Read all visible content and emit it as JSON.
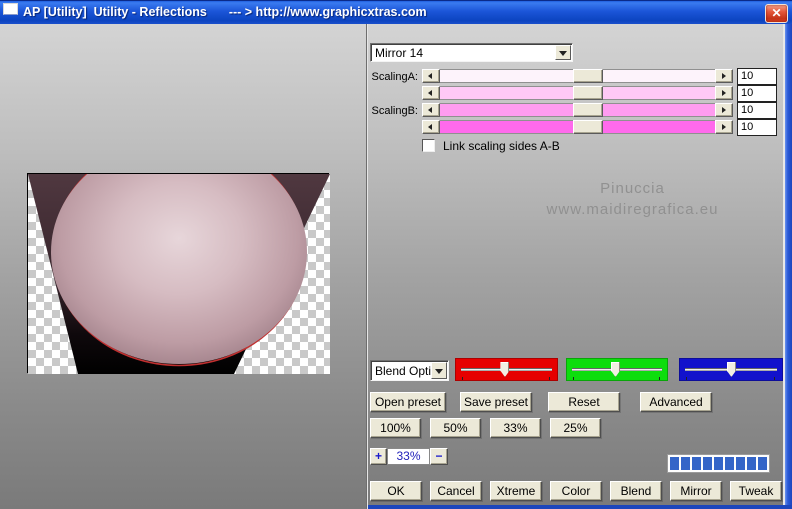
{
  "window": {
    "title_left": "AP [Utility]  Utility - Reflections",
    "title_right": "--- > http://www.graphicxtras.com",
    "close_label": "✕"
  },
  "mirror_select": {
    "value": "Mirror 14"
  },
  "scaling": {
    "rows": [
      {
        "label": "ScalingA:",
        "value": "10",
        "track_color": "#fdf3fb"
      },
      {
        "label": "",
        "value": "10",
        "track_color": "#ffc9f6"
      },
      {
        "label": "ScalingB:",
        "value": "10",
        "track_color": "#ff9cf0"
      },
      {
        "label": "",
        "value": "10",
        "track_color": "#ff6aec"
      }
    ],
    "link_checkbox_label": "Link scaling sides A-B",
    "link_checked": false
  },
  "watermark": {
    "line1": "Pinuccia",
    "line2": "www.maidiregrafica.eu"
  },
  "blend": {
    "select_value": "Blend Optio",
    "channel_sliders": [
      {
        "name": "red",
        "color": "#e60000",
        "thumb_left": "44%"
      },
      {
        "name": "green",
        "color": "#0ddd0d",
        "thumb_left": "44%"
      },
      {
        "name": "blue",
        "color": "#1212cc",
        "thumb_left": "46%"
      }
    ]
  },
  "preset_buttons": [
    {
      "label": "Open preset"
    },
    {
      "label": "Save preset"
    },
    {
      "label": "Reset"
    },
    {
      "label": "Advanced"
    }
  ],
  "zoom_buttons": [
    {
      "label": "100%"
    },
    {
      "label": "50%"
    },
    {
      "label": "33%"
    },
    {
      "label": "25%"
    }
  ],
  "zoom_stepper": {
    "plus": "+",
    "value": "33%",
    "minus": "−"
  },
  "progress": {
    "segments": 9,
    "color": "#3465c8"
  },
  "action_buttons": [
    {
      "label": "OK"
    },
    {
      "label": "Cancel"
    },
    {
      "label": "Xtreme"
    },
    {
      "label": "Color"
    },
    {
      "label": "Blend"
    },
    {
      "label": "Mirror"
    },
    {
      "label": "Tweak"
    }
  ]
}
